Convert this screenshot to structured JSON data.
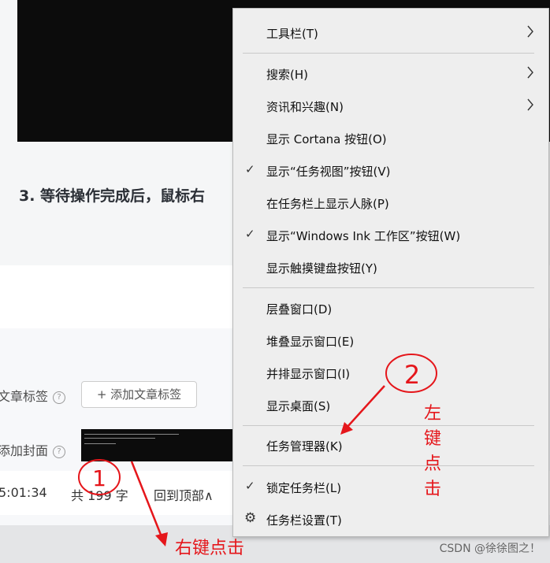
{
  "background": {
    "step_text": "3. 等待操作完成后，鼠标右",
    "tag_label": "文章标签",
    "add_tag_button": "+ 添加文章标签",
    "cover_label": "添加封面",
    "time": "5:01:34",
    "word_count": "共 199 字",
    "back_to_top": "回到顶部∧"
  },
  "menu": {
    "items": [
      {
        "label": "工具栏(T)",
        "checked": false,
        "submenu": true
      },
      {
        "label": "搜索(H)",
        "checked": false,
        "submenu": true
      },
      {
        "label": "资讯和兴趣(N)",
        "checked": false,
        "submenu": true
      },
      {
        "label": "显示 Cortana 按钮(O)",
        "checked": false,
        "submenu": false
      },
      {
        "label": "显示“任务视图”按钮(V)",
        "checked": true,
        "submenu": false
      },
      {
        "label": "在任务栏上显示人脉(P)",
        "checked": false,
        "submenu": false
      },
      {
        "label": "显示“Windows Ink 工作区”按钮(W)",
        "checked": true,
        "submenu": false
      },
      {
        "label": "显示触摸键盘按钮(Y)",
        "checked": false,
        "submenu": false
      },
      {
        "label": "层叠窗口(D)",
        "checked": false,
        "submenu": false
      },
      {
        "label": "堆叠显示窗口(E)",
        "checked": false,
        "submenu": false
      },
      {
        "label": "并排显示窗口(I)",
        "checked": false,
        "submenu": false
      },
      {
        "label": "显示桌面(S)",
        "checked": false,
        "submenu": false
      },
      {
        "label": "任务管理器(K)",
        "checked": false,
        "submenu": false
      },
      {
        "label": "锁定任务栏(L)",
        "checked": true,
        "submenu": false
      },
      {
        "label": "任务栏设置(T)",
        "checked": false,
        "submenu": false,
        "icon": "gear-icon"
      }
    ],
    "check_glyph": "✓",
    "gear_glyph": "⚙"
  },
  "annotations": {
    "circle_1": "1",
    "circle_2": "2",
    "right_click": "右键点击",
    "left_click": "左键点击",
    "color": "#e5161b"
  },
  "watermark": "CSDN @徐徐图之！"
}
